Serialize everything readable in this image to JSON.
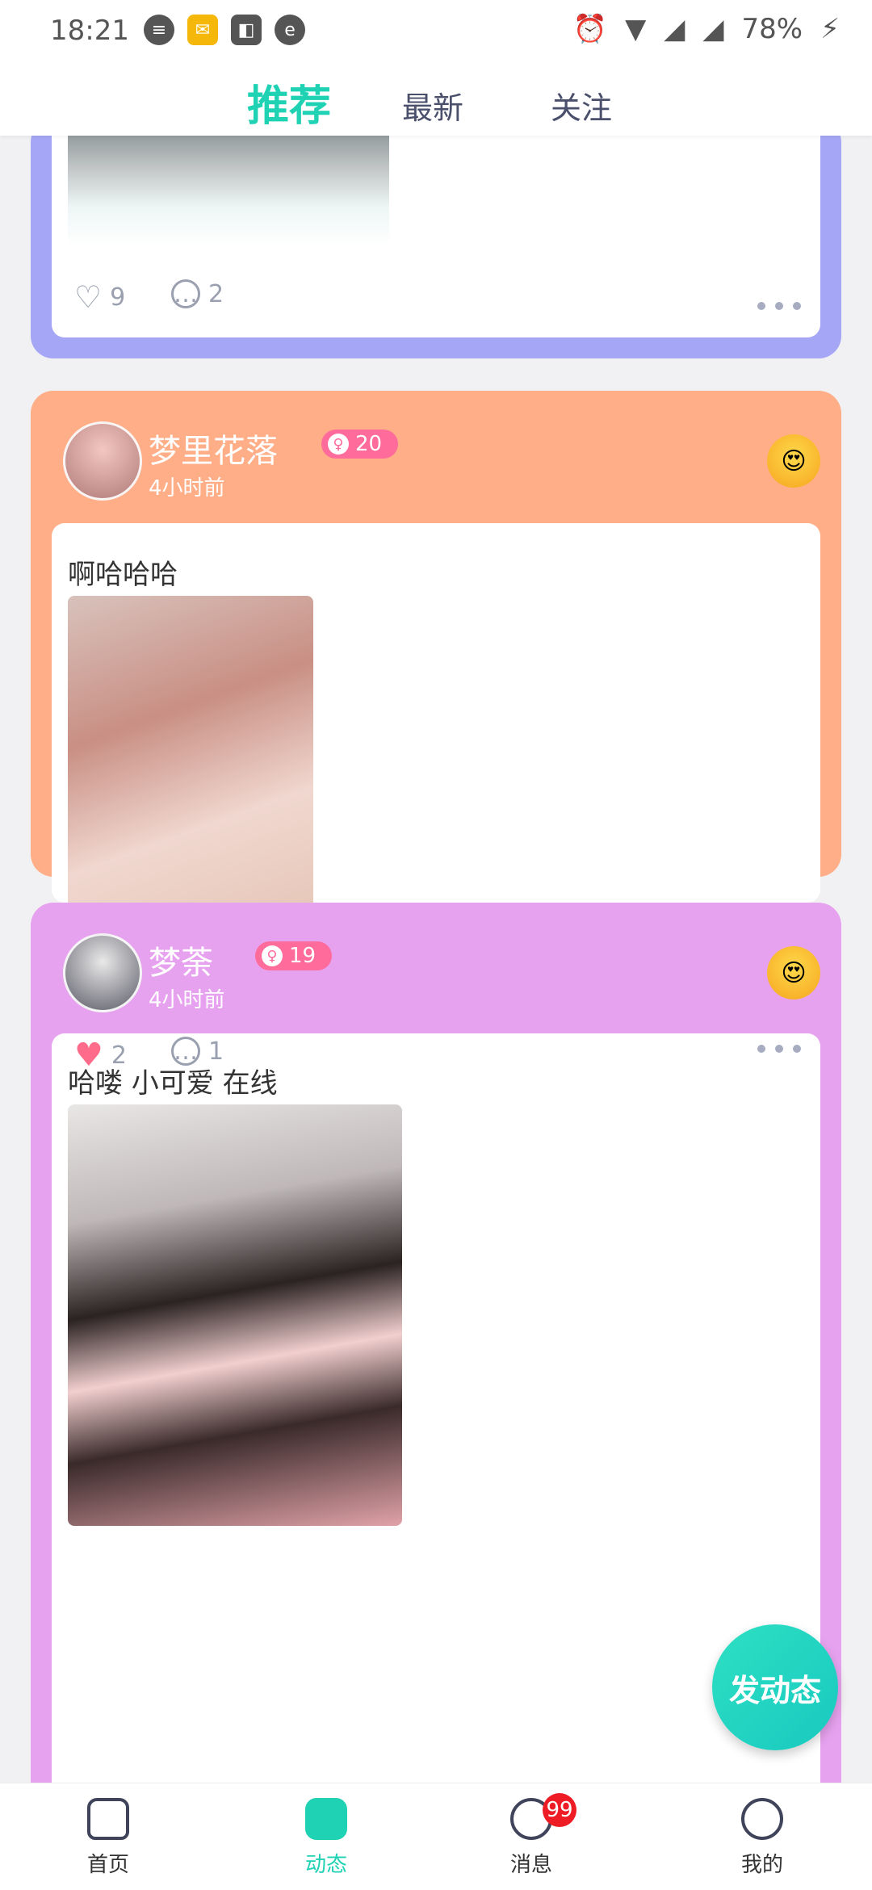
{
  "status_bar": {
    "time": "18:21",
    "battery": "78%"
  },
  "tabs": [
    {
      "label": "推荐",
      "active": true
    },
    {
      "label": "最新",
      "active": false
    },
    {
      "label": "关注",
      "active": false
    }
  ],
  "posts": [
    {
      "likes": "9",
      "comments": "2",
      "accent": "#a5a6f6"
    },
    {
      "username": "梦里花落",
      "age": "20",
      "time": "4小时前",
      "text": "啊哈哈哈",
      "likes": "2",
      "comments": "1",
      "accent": "#ffae87",
      "liked": true
    },
    {
      "username": "梦荼",
      "age": "19",
      "time": "4小时前",
      "text": "哈喽 小可爱 在线",
      "accent": "#e7a2ef"
    }
  ],
  "fab": {
    "label": "发动态"
  },
  "bottom_nav": [
    {
      "label": "首页",
      "icon": "home-icon",
      "active": false
    },
    {
      "label": "动态",
      "icon": "heart-shield-icon",
      "active": true
    },
    {
      "label": "消息",
      "icon": "chat-icon",
      "active": false,
      "badge": "99"
    },
    {
      "label": "我的",
      "icon": "smile-icon",
      "active": false
    }
  ]
}
